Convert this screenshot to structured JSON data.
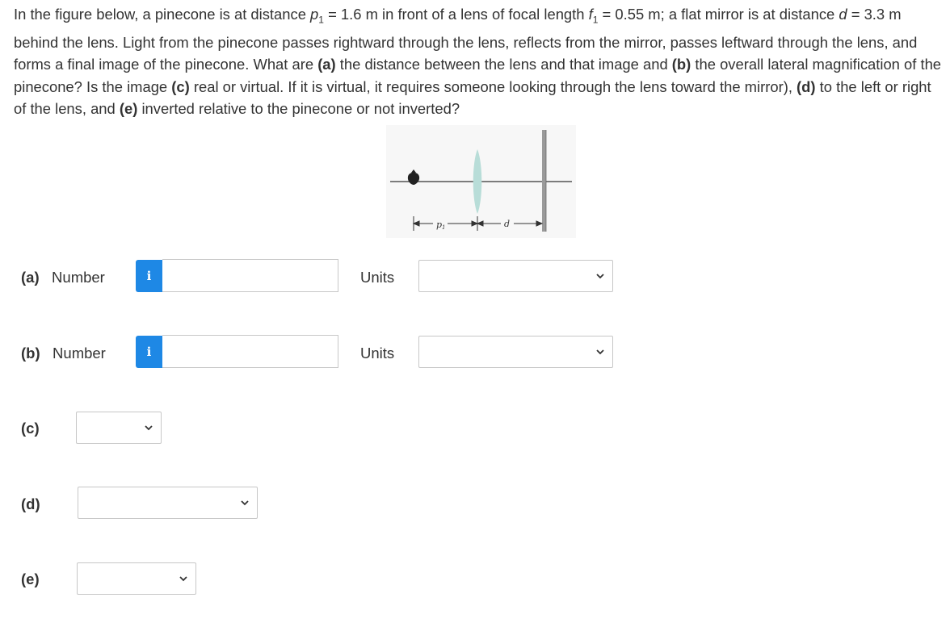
{
  "question": {
    "s1": "In the figure below, a pinecone is at distance ",
    "p_sym": "p",
    "p_sub": "1",
    "s2": " = 1.6 m in front of a lens of focal length ",
    "f_sym": "f",
    "f_sub": "1",
    "s3": " = 0.55 m; a flat mirror is at distance ",
    "d_sym": "d",
    "s4": " = 3.3 m behind the lens. Light from the pinecone passes rightward through the lens, reflects from the mirror, passes leftward through the lens, and forms a final image of the pinecone. What are ",
    "a_tag": "(a)",
    "s5": " the distance between the lens and that image and ",
    "b_tag": "(b)",
    "s6": " the overall lateral magnification of the pinecone? Is the image ",
    "c_tag": "(c)",
    "s7": " real or virtual. If it is virtual, it requires someone looking through the lens toward the mirror), ",
    "d_tag": "(d)",
    "s8": " to the left or right of the lens, and ",
    "e_tag": "(e)",
    "s9": " inverted relative to the pinecone or not inverted?"
  },
  "figure": {
    "label_p": "p",
    "label_p_sub": "1",
    "label_d": "d",
    "lens_color": "#b8ddd8",
    "mirror_color": "#9a9a9a"
  },
  "rows": {
    "a": {
      "tag": "(a)",
      "number_label": "Number",
      "units_label": "Units",
      "value": "",
      "units_value": ""
    },
    "b": {
      "tag": "(b)",
      "number_label": "Number",
      "units_label": "Units",
      "value": "",
      "units_value": ""
    },
    "c": {
      "tag": "(c)",
      "value": ""
    },
    "d": {
      "tag": "(d)",
      "value": ""
    },
    "e": {
      "tag": "(e)",
      "value": ""
    }
  },
  "info_icon_glyph": "i",
  "accent_color": "#1e88e5"
}
